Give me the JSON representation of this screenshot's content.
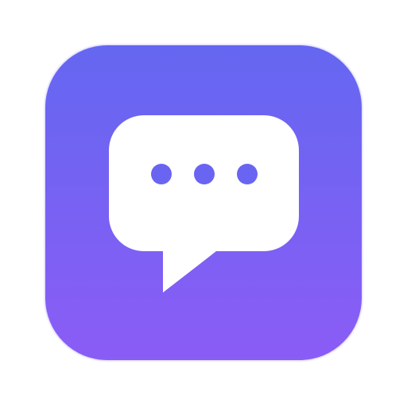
{
  "app_icon": {
    "icon": "chat-bubble-icon",
    "colors": {
      "gradient_top": "#6467F1",
      "gradient_bottom": "#8B5CF6",
      "bubble": "#FFFFFF",
      "dots": "#6A64F2"
    },
    "typing_dots": 3
  }
}
